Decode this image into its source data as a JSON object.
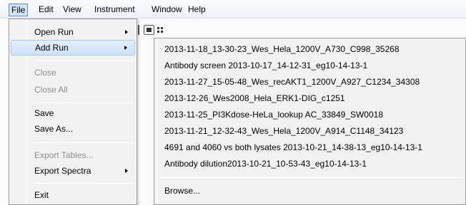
{
  "menubar": {
    "items": [
      {
        "label": "File"
      },
      {
        "label": "Edit"
      },
      {
        "label": "View"
      },
      {
        "label": "Instrument"
      },
      {
        "label": "Window"
      },
      {
        "label": "Help"
      }
    ]
  },
  "file_menu": {
    "items": [
      {
        "label": "Open Run"
      },
      {
        "label": "Add Run"
      },
      {
        "label": "Close"
      },
      {
        "label": "Close All"
      },
      {
        "label": "Save"
      },
      {
        "label": "Save As..."
      },
      {
        "label": "Export Tables..."
      },
      {
        "label": "Export Spectra"
      },
      {
        "label": "Exit"
      }
    ]
  },
  "add_run_submenu": {
    "items": [
      {
        "label": "2013-11-18_13-30-23_Wes_Hela_1200V_A730_C998_35268"
      },
      {
        "label": "Antibody screen 2013-10-17_14-12-31_eg10-14-13-1"
      },
      {
        "label": "2013-11-27_15-05-48_Wes_recAKT1_1200V_A927_C1234_34308"
      },
      {
        "label": "2013-12-26_Wes2008_Hela_ERK1-DIG_c1251"
      },
      {
        "label": "2013-11-25_PI3Kdose-HeLa_lookup AC_33849_SW0018"
      },
      {
        "label": "2013-11-21_12-32-43_Wes_Hela_1200V_A914_C1148_34123"
      },
      {
        "label": "4691 and 4060 vs both lysates 2013-10-21_14-38-13_eg10-14-13-1"
      },
      {
        "label": "Antibody dilution2013-10-21_10-53-43_eg10-14-13-1"
      },
      {
        "label": "Browse..."
      }
    ]
  }
}
